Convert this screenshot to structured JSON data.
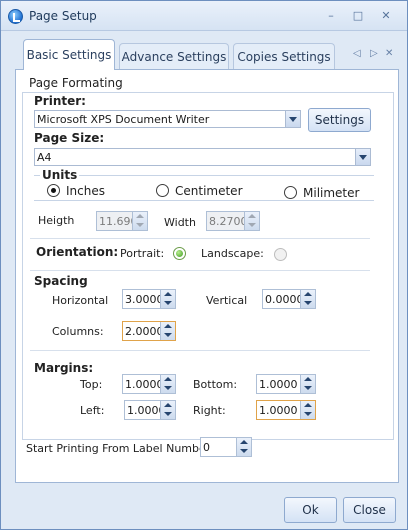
{
  "window": {
    "title": "Page Setup",
    "minimize": "–",
    "maximize": "□",
    "close": "✕"
  },
  "tabs": [
    {
      "label": "Basic Settings"
    },
    {
      "label": "Advance Settings"
    },
    {
      "label": "Copies Settings"
    }
  ],
  "tab_nav": {
    "prev": "◁",
    "next": "▷",
    "close": "✕"
  },
  "page_formatting": {
    "legend": "Page Formating",
    "printer_label": "Printer:",
    "printer_value": "Microsoft XPS Document Writer",
    "settings_button": "Settings",
    "page_size_label": "Page Size:",
    "page_size_value": "A4",
    "units_label": "Units",
    "units_options": [
      "Inches",
      "Centimeter",
      "Milimeter"
    ],
    "height_label": "Heigth",
    "height_value": "11.6900",
    "width_label": "Width",
    "width_value": "8.2700",
    "orientation_label": "Orientation:",
    "portrait_label": "Portrait:",
    "landscape_label": "Landscape:",
    "spacing_label": "Spacing",
    "horizontal_label": "Horizontal",
    "horizontal_value": "3.0000",
    "vertical_label": "Vertical",
    "vertical_value": "0.0000",
    "columns_label": "Columns:",
    "columns_value": "2.0000",
    "margins_label": "Margins:",
    "top_label": "Top:",
    "top_value": "1.0000",
    "bottom_label": "Bottom:",
    "bottom_value": "1.0000",
    "left_label": "Left:",
    "left_value": "1.0000",
    "right_label": "Right:",
    "right_value": "1.0000"
  },
  "start_printing": {
    "label": "Start Printing From Label Number",
    "value": "0"
  },
  "footer": {
    "ok_label": "Ok",
    "close_label": "Close"
  },
  "colors": {
    "title_text": "#1e395b",
    "accent_blue": "#9fb6d6",
    "radio_green": "#3e9a22",
    "focus_orange": "#e0a34a"
  },
  "state": {
    "selected_unit": "Inches",
    "orientation": "Portrait"
  }
}
